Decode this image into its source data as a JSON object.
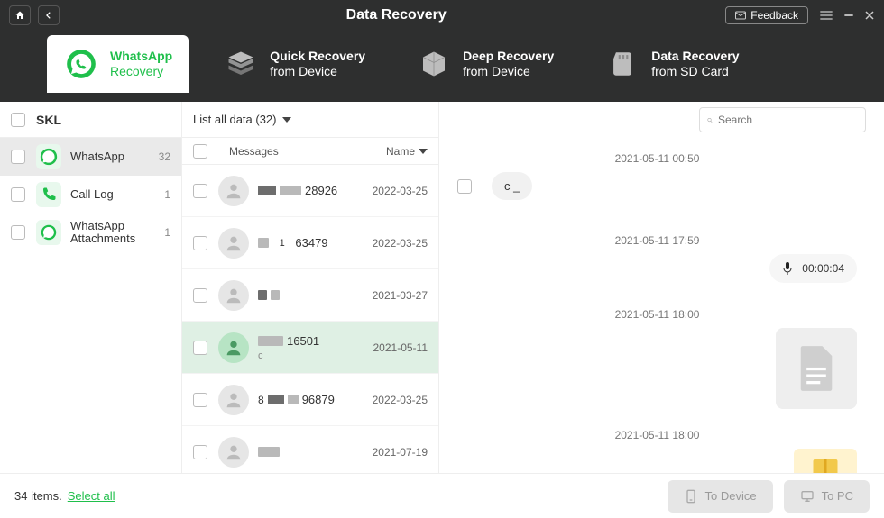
{
  "title": "Data Recovery",
  "feedback": "Feedback",
  "tabs": [
    {
      "l1": "WhatsApp",
      "l2": "Recovery"
    },
    {
      "l1": "Quick Recovery",
      "l2": "from Device"
    },
    {
      "l1": "Deep Recovery",
      "l2": "from Device"
    },
    {
      "l1": "Data Recovery",
      "l2": "from SD Card"
    }
  ],
  "device": "SKL",
  "side_items": [
    {
      "label": "WhatsApp",
      "count": "32"
    },
    {
      "label": "Call Log",
      "count": "1"
    },
    {
      "label": "WhatsApp Attachments",
      "count": "1"
    }
  ],
  "filter_label": "List all data (32)",
  "col_messages": "Messages",
  "col_name": "Name",
  "messages": [
    {
      "num": "28926",
      "date": "2022-03-25",
      "sub": ""
    },
    {
      "num": "63479",
      "date": "2022-03-25",
      "sub": ""
    },
    {
      "num": "",
      "date": "2021-03-27",
      "sub": ""
    },
    {
      "num": "16501",
      "date": "2021-05-11",
      "sub": "c"
    },
    {
      "num": "96879",
      "date": "2022-03-25",
      "sub": ""
    },
    {
      "num": "",
      "date": "2021-07-19",
      "sub": ""
    }
  ],
  "search_placeholder": "Search",
  "thread": {
    "ts1": "2021-05-11 00:50",
    "bubble": "c _",
    "ts2": "2021-05-11 17:59",
    "voice_duration": "00:00:04",
    "ts3": "2021-05-11 18:00",
    "ts4": "2021-05-11 18:00"
  },
  "footer": {
    "status": "34 items.",
    "select_all": "Select all",
    "to_device": "To Device",
    "to_pc": "To PC"
  }
}
